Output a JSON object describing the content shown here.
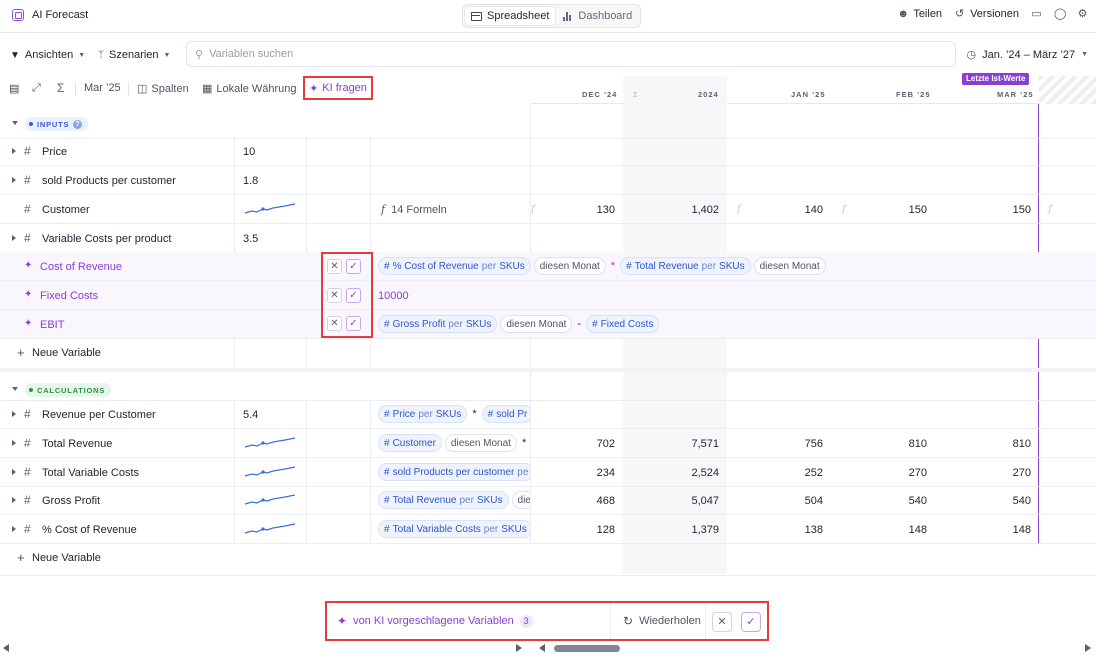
{
  "app": {
    "title": "AI Forecast"
  },
  "views": [
    {
      "label": "Spreadsheet",
      "active": true
    },
    {
      "label": "Dashboard",
      "active": false
    }
  ],
  "top_actions": {
    "share": "Teilen",
    "versions": "Versionen"
  },
  "filters": {
    "views_label": "Ansichten",
    "scenarios_label": "Szenarien",
    "search_placeholder": "Variablen suchen",
    "date_range": "Jan. ’24 – März ’27"
  },
  "toolbar": {
    "period": "Mar ’25",
    "columns": "Spalten",
    "currency": "Lokale Währung",
    "ask_ai": "KI fragen"
  },
  "columns": {
    "dec24": "DEC ’24",
    "sigma": "Σ",
    "y2024": "2024",
    "jan25": "JAN ’25",
    "feb25": "FEB ’25",
    "mar25": "MAR ’25",
    "actuals_badge": "Letzte Ist-Werte"
  },
  "sections": {
    "inputs": "INPUTS",
    "calculations": "CALCULATIONS",
    "new_variable": "Neue Variable"
  },
  "inputs_rows": [
    {
      "name": "Price",
      "value": "10"
    },
    {
      "name": "sold Products per customer",
      "value": "1.8"
    },
    {
      "name": "Customer",
      "formula": "14 Formeln",
      "dec24": "130",
      "y2024": "1,402",
      "jan25": "140",
      "feb25": "150",
      "mar25": "150"
    },
    {
      "name": "Variable Costs per product",
      "value": "3.5"
    }
  ],
  "ai_rows": [
    {
      "name": "Cost of Revenue"
    },
    {
      "name": "Fixed Costs",
      "value": "10000"
    },
    {
      "name": "EBIT"
    }
  ],
  "ai_formulas": {
    "cost_of_revenue": {
      "a_name": "% Cost of Revenue",
      "a_per": "per",
      "a_dim": "SKUs",
      "a_time": "diesen Monat",
      "op": "*",
      "b_name": "Total Revenue",
      "b_per": "per",
      "b_dim": "SKUs",
      "b_time": "diesen Monat"
    },
    "ebit": {
      "a_name": "Gross Profit",
      "a_per": "per",
      "a_dim": "SKUs",
      "a_time": "diesen Monat",
      "op": "-",
      "b_name": "Fixed Costs"
    }
  },
  "calc_rows": [
    {
      "name": "Revenue per Customer",
      "value": "5.4",
      "chip": "Price",
      "chip_per": "per",
      "chip_dim": "SKUs",
      "op": "*",
      "chip2": "sold Pr"
    },
    {
      "name": "Total Revenue",
      "chip": "Customer",
      "chip_time": "diesen Monat",
      "op": "*",
      "dec24": "702",
      "y2024": "7,571",
      "jan25": "756",
      "feb25": "810",
      "mar25": "810"
    },
    {
      "name": "Total Variable Costs",
      "chip": "sold Products per customer",
      "chip_per": "pe",
      "dec24": "234",
      "y2024": "2,524",
      "jan25": "252",
      "feb25": "270",
      "mar25": "270"
    },
    {
      "name": "Gross Profit",
      "chip": "Total Revenue",
      "chip_per": "per",
      "chip_dim": "SKUs",
      "chip_time": "dies",
      "dec24": "468",
      "y2024": "5,047",
      "jan25": "504",
      "feb25": "540",
      "mar25": "540"
    },
    {
      "name": "% Cost of Revenue",
      "chip": "Total Variable Costs",
      "chip_per": "per",
      "chip_dim": "SKUs",
      "dec24": "128",
      "y2024": "1,379",
      "jan25": "138",
      "feb25": "148",
      "mar25": "148"
    }
  ],
  "ai_bar": {
    "label": "von KI vorgeschlagene Variablen",
    "count": "3",
    "retry": "Wiederholen"
  },
  "colors": {
    "accent": "#8b3fd1",
    "highlight": "#e53b3b",
    "chip_blue": "#2f56c8"
  }
}
